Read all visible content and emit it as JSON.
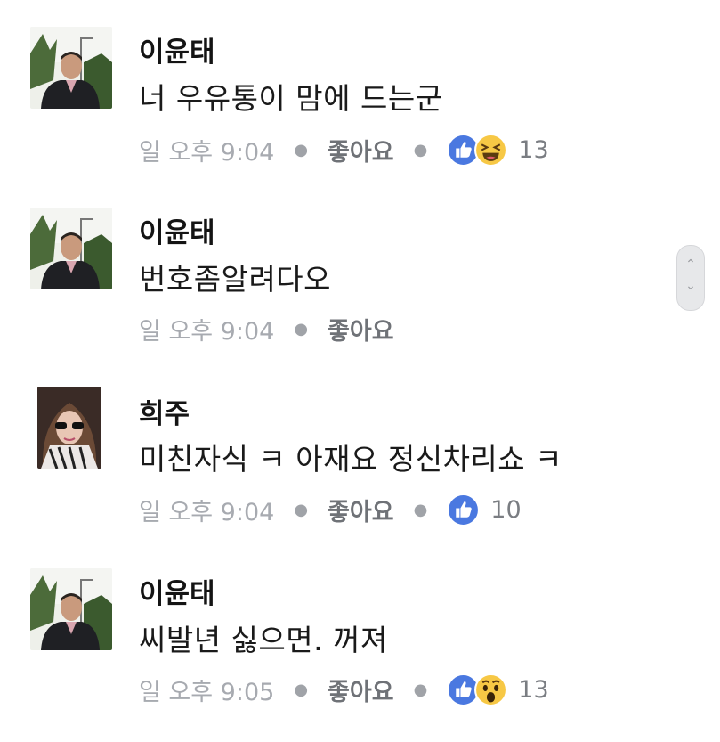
{
  "comments": [
    {
      "author": "이윤태",
      "text": "너 우유통이 맘에 드는군",
      "time": "일 오후 9:04",
      "like_label": "좋아요",
      "reactions": [
        "like-icon",
        "laugh-icon"
      ],
      "reaction_count": "13"
    },
    {
      "author": "이윤태",
      "text": "번호좀알려다오",
      "time": "일 오후 9:04",
      "like_label": "좋아요"
    },
    {
      "author": "희주",
      "text": "미친자식 ㅋ 아재요 정신차리쇼 ㅋ",
      "time": "일 오후 9:04",
      "like_label": "좋아요",
      "reactions": [
        "like-icon"
      ],
      "reaction_count": "10"
    },
    {
      "author": "이윤태",
      "text": "씨발년 싫으면. 꺼져",
      "time": "일 오후 9:05",
      "like_label": "좋아요",
      "reactions": [
        "like-icon",
        "wow-icon"
      ],
      "reaction_count": "13"
    }
  ],
  "scrollbar": {
    "up_icon": "chevron-up-icon",
    "down_icon": "chevron-down-icon",
    "up_glyph": "⌃",
    "down_glyph": "⌄"
  },
  "colors": {
    "like_blue": "#4267b2",
    "reaction_yellow": "#f7c845",
    "meta_gray": "#9a9da3"
  }
}
